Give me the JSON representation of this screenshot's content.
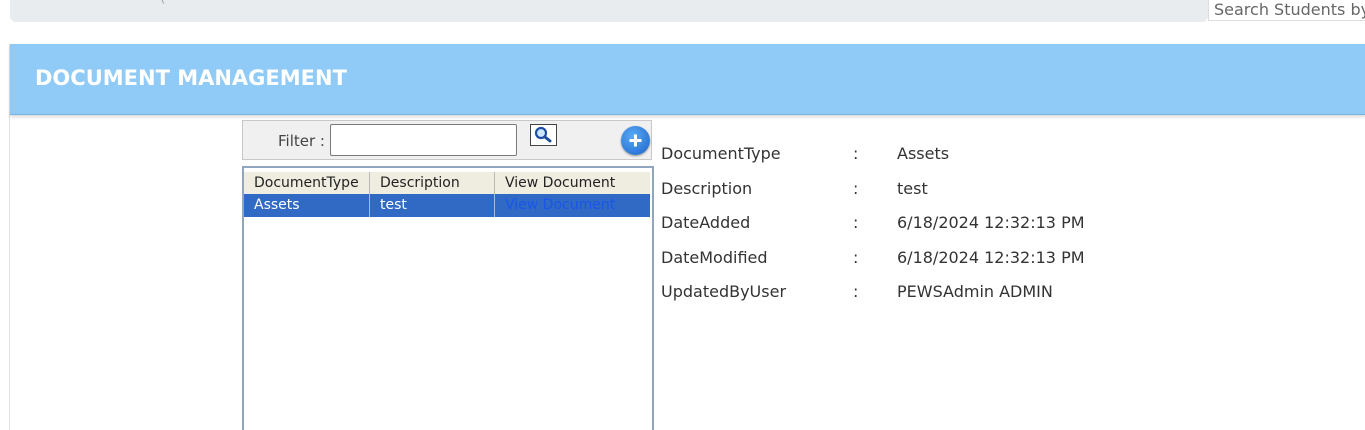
{
  "search": {
    "placeholder": "Search Students by"
  },
  "panel": {
    "title": "DOCUMENT MANAGEMENT"
  },
  "filter": {
    "label": "Filter :",
    "value": ""
  },
  "grid": {
    "headers": [
      "DocumentType",
      "Description",
      "View Document"
    ],
    "rows": [
      {
        "document_type": "Assets",
        "description": "test",
        "view_document": "View Document"
      }
    ]
  },
  "details": [
    {
      "label": "DocumentType",
      "sep": ":",
      "value": "Assets"
    },
    {
      "label": "Description",
      "sep": ":",
      "value": "test"
    },
    {
      "label": "DateAdded",
      "sep": ":",
      "value": "6/18/2024 12:32:13 PM"
    },
    {
      "label": "DateModified",
      "sep": ":",
      "value": "6/18/2024 12:32:13 PM"
    },
    {
      "label": "UpdatedByUser",
      "sep": ":",
      "value": "PEWSAdmin ADMIN"
    }
  ],
  "icons": {
    "search": "magnifier-icon",
    "add": "plus-circle-icon"
  },
  "colors": {
    "header": "#90caf6",
    "selected_row": "#316ac5",
    "link": "#1a56e8"
  }
}
